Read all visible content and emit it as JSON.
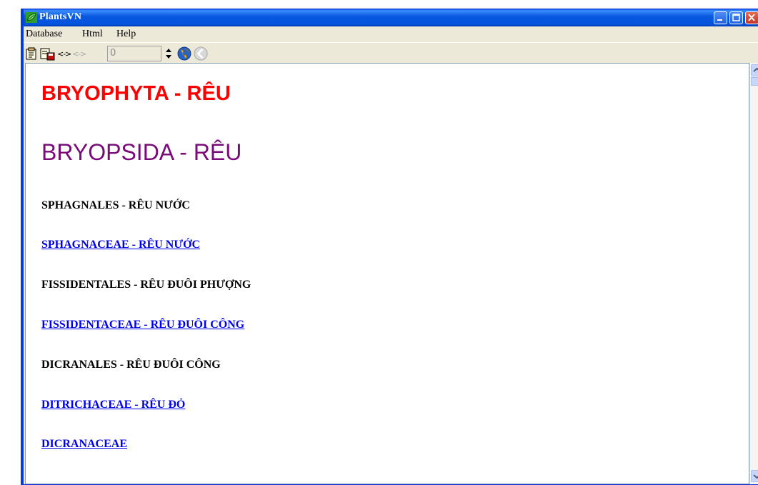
{
  "window": {
    "title": "PlantsVN"
  },
  "menu": {
    "items": [
      "Database",
      "Html",
      "Help"
    ]
  },
  "toolbar": {
    "nav_forward_label": "<->",
    "nav_disabled_label": "<->",
    "spin_value": "0",
    "icons": [
      "copy-icon",
      "save-icon",
      "globe-icon",
      "back-arrow-icon"
    ]
  },
  "content": {
    "phylum": "BRYOPHYTA - RÊU",
    "class": "BRYOPSIDA - RÊU",
    "entries": [
      {
        "type": "order",
        "text": "SPHAGNALES - RÊU NƯỚC"
      },
      {
        "type": "family",
        "text": "SPHAGNACEAE - RÊU NƯỚC"
      },
      {
        "type": "order",
        "text": "FISSIDENTALES - RÊU ĐUÔI PHƯỢNG"
      },
      {
        "type": "family",
        "text": "FISSIDENTACEAE - RÊU ĐUÔI CÔNG"
      },
      {
        "type": "order",
        "text": "DICRANALES - RÊU ĐUÔI CÔNG"
      },
      {
        "type": "family",
        "text": "DITRICHACEAE - RÊU ĐỎ"
      },
      {
        "type": "family",
        "text": "DICRANACEAE"
      }
    ]
  },
  "colors": {
    "phylum": "#ff0000",
    "class": "#7a0a7a",
    "link": "#0000ee",
    "titlebar": "#0858e0"
  }
}
